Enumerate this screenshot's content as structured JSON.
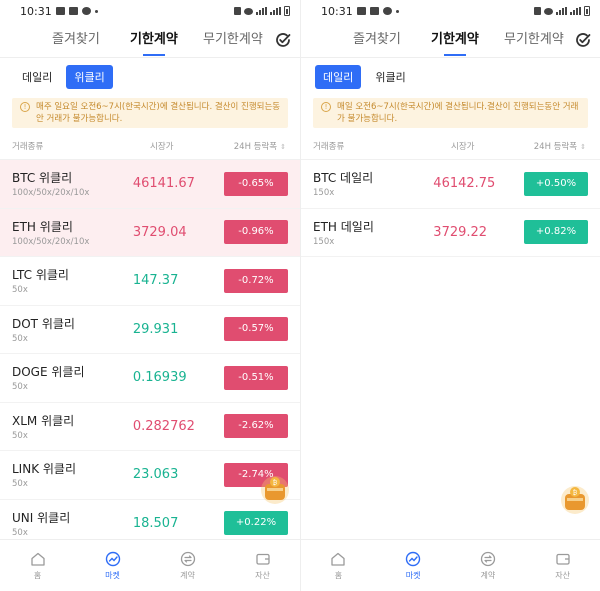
{
  "left": {
    "status": {
      "time": "10:31",
      "battery": ""
    },
    "top_tabs": [
      {
        "label": "즐겨찾기"
      },
      {
        "label": "기한계약"
      },
      {
        "label": "무기한계약"
      }
    ],
    "sub_tabs": [
      {
        "label": "데일리"
      },
      {
        "label": "위클리"
      }
    ],
    "notice": "매주 일요일 오전6~7시(한국시간)에 결산됩니다. 결산이 진행되는동안 거래가 불가능합니다.",
    "headers": {
      "name": "거래종류",
      "price": "시장가",
      "change": "24H 등락폭"
    },
    "rows": [
      {
        "name": "BTC 위클리",
        "leverage": "100x/50x/20x/10x",
        "price": "46141.67",
        "change": "-0.65%"
      },
      {
        "name": "ETH 위클리",
        "leverage": "100x/50x/20x/10x",
        "price": "3729.04",
        "change": "-0.96%"
      },
      {
        "name": "LTC 위클리",
        "leverage": "50x",
        "price": "147.37",
        "change": "-0.72%"
      },
      {
        "name": "DOT 위클리",
        "leverage": "50x",
        "price": "29.931",
        "change": "-0.57%"
      },
      {
        "name": "DOGE 위클리",
        "leverage": "50x",
        "price": "0.16939",
        "change": "-0.51%"
      },
      {
        "name": "XLM 위클리",
        "leverage": "50x",
        "price": "0.282762",
        "change": "-2.62%"
      },
      {
        "name": "LINK 위클리",
        "leverage": "50x",
        "price": "23.063",
        "change": "-2.74%"
      },
      {
        "name": "UNI 위클리",
        "leverage": "50x",
        "price": "18.507",
        "change": "+0.22%"
      }
    ],
    "nav": [
      {
        "label": "홈",
        "icon": "home-icon"
      },
      {
        "label": "마켓",
        "icon": "market-icon"
      },
      {
        "label": "계약",
        "icon": "contract-icon"
      },
      {
        "label": "자산",
        "icon": "wallet-icon"
      }
    ]
  },
  "right": {
    "status": {
      "time": "10:31"
    },
    "top_tabs": [
      {
        "label": "즐겨찾기"
      },
      {
        "label": "기한계약"
      },
      {
        "label": "무기한계약"
      }
    ],
    "sub_tabs": [
      {
        "label": "데일리"
      },
      {
        "label": "위클리"
      }
    ],
    "notice": "매일 오전6~7시(한국시간)에 결산됩니다.결산이 진행되는동안 거래가 불가능합니다.",
    "headers": {
      "name": "거래종류",
      "price": "시장가",
      "change": "24H 등락폭"
    },
    "rows": [
      {
        "name": "BTC 데일리",
        "leverage": "150x",
        "price": "46142.75",
        "change": "+0.50%"
      },
      {
        "name": "ETH 데일리",
        "leverage": "150x",
        "price": "3729.22",
        "change": "+0.82%"
      }
    ],
    "nav": [
      {
        "label": "홈",
        "icon": "home-icon"
      },
      {
        "label": "마켓",
        "icon": "market-icon"
      },
      {
        "label": "계약",
        "icon": "contract-icon"
      },
      {
        "label": "자산",
        "icon": "wallet-icon"
      }
    ]
  },
  "colors": {
    "accent": "#2f6df6",
    "down": "#e04d70",
    "up": "#1fbf98",
    "up_text": "#19b391",
    "highlight_row": "#fdeef0",
    "notice_bg": "#fdf3e0"
  }
}
